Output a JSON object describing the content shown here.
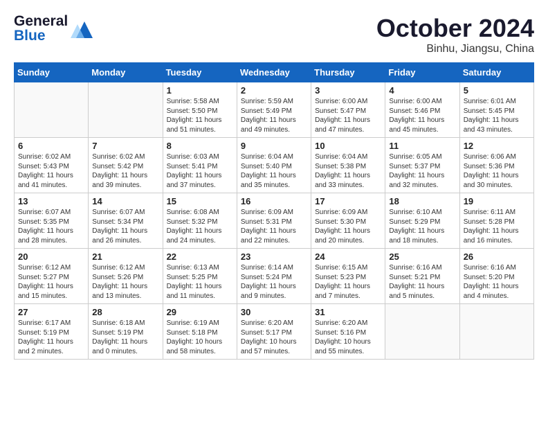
{
  "header": {
    "logo_line1": "General",
    "logo_line2": "Blue",
    "month": "October 2024",
    "location": "Binhu, Jiangsu, China"
  },
  "columns": [
    "Sunday",
    "Monday",
    "Tuesday",
    "Wednesday",
    "Thursday",
    "Friday",
    "Saturday"
  ],
  "weeks": [
    [
      {
        "day": "",
        "content": ""
      },
      {
        "day": "",
        "content": ""
      },
      {
        "day": "1",
        "content": "Sunrise: 5:58 AM\nSunset: 5:50 PM\nDaylight: 11 hours and 51 minutes."
      },
      {
        "day": "2",
        "content": "Sunrise: 5:59 AM\nSunset: 5:49 PM\nDaylight: 11 hours and 49 minutes."
      },
      {
        "day": "3",
        "content": "Sunrise: 6:00 AM\nSunset: 5:47 PM\nDaylight: 11 hours and 47 minutes."
      },
      {
        "day": "4",
        "content": "Sunrise: 6:00 AM\nSunset: 5:46 PM\nDaylight: 11 hours and 45 minutes."
      },
      {
        "day": "5",
        "content": "Sunrise: 6:01 AM\nSunset: 5:45 PM\nDaylight: 11 hours and 43 minutes."
      }
    ],
    [
      {
        "day": "6",
        "content": "Sunrise: 6:02 AM\nSunset: 5:43 PM\nDaylight: 11 hours and 41 minutes."
      },
      {
        "day": "7",
        "content": "Sunrise: 6:02 AM\nSunset: 5:42 PM\nDaylight: 11 hours and 39 minutes."
      },
      {
        "day": "8",
        "content": "Sunrise: 6:03 AM\nSunset: 5:41 PM\nDaylight: 11 hours and 37 minutes."
      },
      {
        "day": "9",
        "content": "Sunrise: 6:04 AM\nSunset: 5:40 PM\nDaylight: 11 hours and 35 minutes."
      },
      {
        "day": "10",
        "content": "Sunrise: 6:04 AM\nSunset: 5:38 PM\nDaylight: 11 hours and 33 minutes."
      },
      {
        "day": "11",
        "content": "Sunrise: 6:05 AM\nSunset: 5:37 PM\nDaylight: 11 hours and 32 minutes."
      },
      {
        "day": "12",
        "content": "Sunrise: 6:06 AM\nSunset: 5:36 PM\nDaylight: 11 hours and 30 minutes."
      }
    ],
    [
      {
        "day": "13",
        "content": "Sunrise: 6:07 AM\nSunset: 5:35 PM\nDaylight: 11 hours and 28 minutes."
      },
      {
        "day": "14",
        "content": "Sunrise: 6:07 AM\nSunset: 5:34 PM\nDaylight: 11 hours and 26 minutes."
      },
      {
        "day": "15",
        "content": "Sunrise: 6:08 AM\nSunset: 5:32 PM\nDaylight: 11 hours and 24 minutes."
      },
      {
        "day": "16",
        "content": "Sunrise: 6:09 AM\nSunset: 5:31 PM\nDaylight: 11 hours and 22 minutes."
      },
      {
        "day": "17",
        "content": "Sunrise: 6:09 AM\nSunset: 5:30 PM\nDaylight: 11 hours and 20 minutes."
      },
      {
        "day": "18",
        "content": "Sunrise: 6:10 AM\nSunset: 5:29 PM\nDaylight: 11 hours and 18 minutes."
      },
      {
        "day": "19",
        "content": "Sunrise: 6:11 AM\nSunset: 5:28 PM\nDaylight: 11 hours and 16 minutes."
      }
    ],
    [
      {
        "day": "20",
        "content": "Sunrise: 6:12 AM\nSunset: 5:27 PM\nDaylight: 11 hours and 15 minutes."
      },
      {
        "day": "21",
        "content": "Sunrise: 6:12 AM\nSunset: 5:26 PM\nDaylight: 11 hours and 13 minutes."
      },
      {
        "day": "22",
        "content": "Sunrise: 6:13 AM\nSunset: 5:25 PM\nDaylight: 11 hours and 11 minutes."
      },
      {
        "day": "23",
        "content": "Sunrise: 6:14 AM\nSunset: 5:24 PM\nDaylight: 11 hours and 9 minutes."
      },
      {
        "day": "24",
        "content": "Sunrise: 6:15 AM\nSunset: 5:23 PM\nDaylight: 11 hours and 7 minutes."
      },
      {
        "day": "25",
        "content": "Sunrise: 6:16 AM\nSunset: 5:21 PM\nDaylight: 11 hours and 5 minutes."
      },
      {
        "day": "26",
        "content": "Sunrise: 6:16 AM\nSunset: 5:20 PM\nDaylight: 11 hours and 4 minutes."
      }
    ],
    [
      {
        "day": "27",
        "content": "Sunrise: 6:17 AM\nSunset: 5:19 PM\nDaylight: 11 hours and 2 minutes."
      },
      {
        "day": "28",
        "content": "Sunrise: 6:18 AM\nSunset: 5:19 PM\nDaylight: 11 hours and 0 minutes."
      },
      {
        "day": "29",
        "content": "Sunrise: 6:19 AM\nSunset: 5:18 PM\nDaylight: 10 hours and 58 minutes."
      },
      {
        "day": "30",
        "content": "Sunrise: 6:20 AM\nSunset: 5:17 PM\nDaylight: 10 hours and 57 minutes."
      },
      {
        "day": "31",
        "content": "Sunrise: 6:20 AM\nSunset: 5:16 PM\nDaylight: 10 hours and 55 minutes."
      },
      {
        "day": "",
        "content": ""
      },
      {
        "day": "",
        "content": ""
      }
    ]
  ]
}
